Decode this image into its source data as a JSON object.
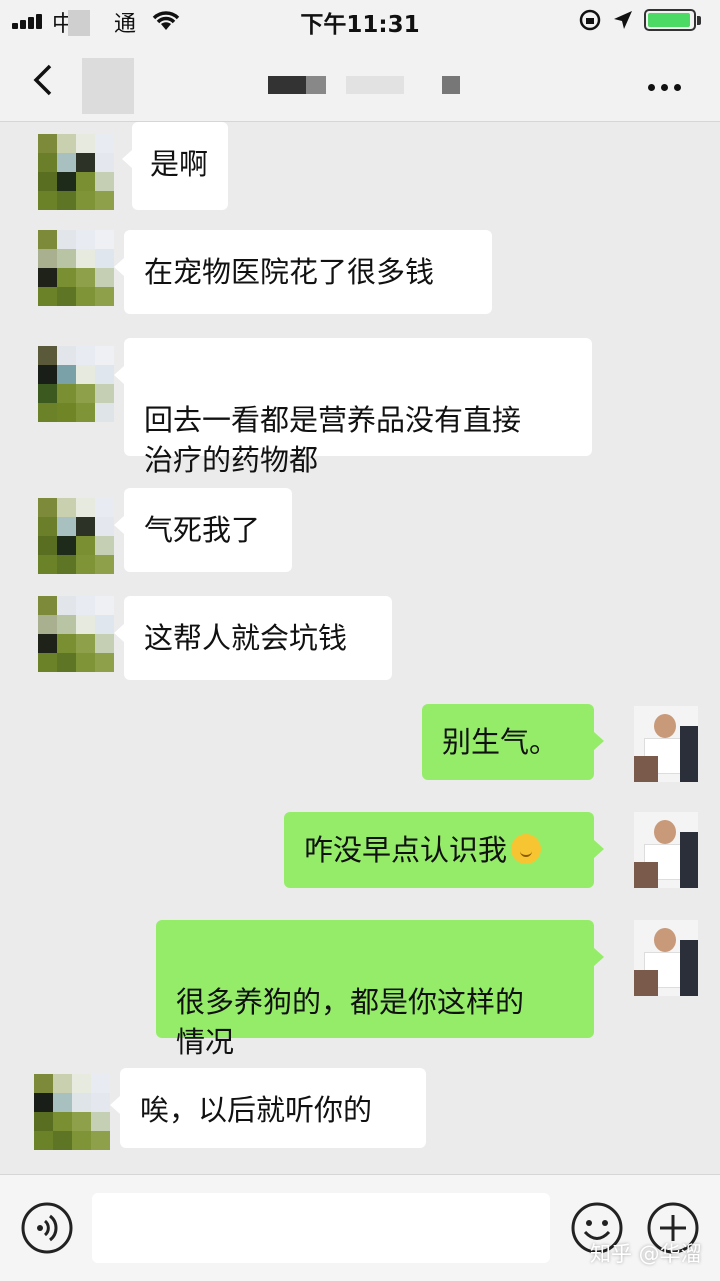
{
  "status_bar": {
    "carrier": "中",
    "carrier_suffix": "通",
    "time": "下午11:31"
  },
  "nav_bar": {
    "back_icon": "chevron-left-icon",
    "more_icon": "more-dots-icon"
  },
  "messages": [
    {
      "side": "left",
      "text": "是啊"
    },
    {
      "side": "left",
      "text": "在宠物医院花了很多钱"
    },
    {
      "side": "left",
      "text": "回去一看都是营养品没有直接\n治疗的药物都"
    },
    {
      "side": "left",
      "text": "气死我了"
    },
    {
      "side": "left",
      "text": "这帮人就会坑钱"
    },
    {
      "side": "right",
      "text": "别生气。"
    },
    {
      "side": "right",
      "text": "咋没早点认识我",
      "emoji": "thinking-face-icon"
    },
    {
      "side": "right",
      "text": "很多养狗的，都是你这样的\n情况"
    },
    {
      "side": "left",
      "text": "唉，以后就听你的"
    }
  ],
  "input_bar": {
    "voice_icon": "voice-icon",
    "emoji_icon": "emoji-smile-icon",
    "plus_icon": "plus-icon"
  },
  "watermark": "知乎 @华溜",
  "colors": {
    "right_bubble": "#95ec69",
    "left_bubble": "#ffffff",
    "background": "#ebebeb"
  }
}
